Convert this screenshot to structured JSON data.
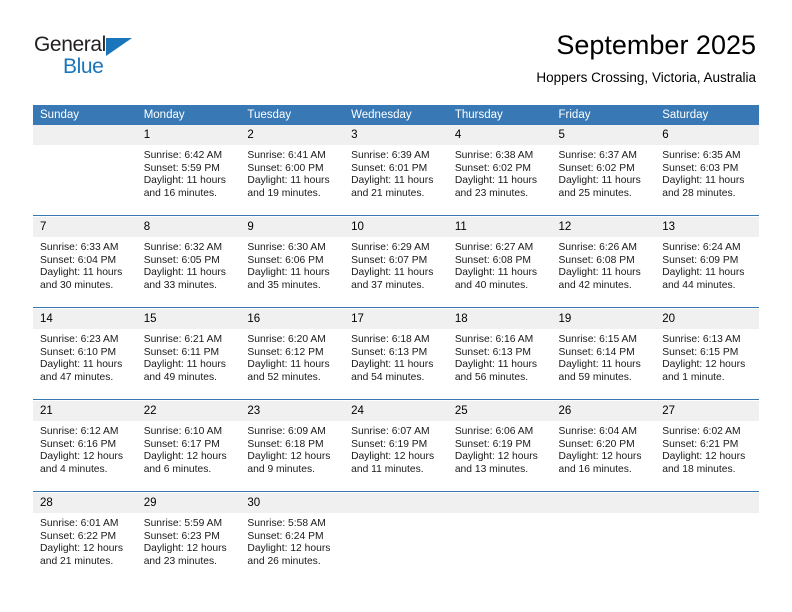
{
  "brand": {
    "name_top": "General",
    "name_bottom": "Blue",
    "triangle_color": "#1b75bb",
    "top_text_color": "#231f20"
  },
  "header": {
    "month_title": "September 2025",
    "location": "Hoppers Crossing, Victoria, Australia",
    "header_bg": "#3878b4",
    "date_bg": "#f0f0f0"
  },
  "calendar": {
    "weekday_headers": [
      "Sunday",
      "Monday",
      "Tuesday",
      "Wednesday",
      "Thursday",
      "Friday",
      "Saturday"
    ],
    "weeks": [
      [
        {
          "day": "",
          "sunrise": "",
          "sunset": "",
          "daylight1": "",
          "daylight2": ""
        },
        {
          "day": "1",
          "sunrise": "Sunrise: 6:42 AM",
          "sunset": "Sunset: 5:59 PM",
          "daylight1": "Daylight: 11 hours",
          "daylight2": "and 16 minutes."
        },
        {
          "day": "2",
          "sunrise": "Sunrise: 6:41 AM",
          "sunset": "Sunset: 6:00 PM",
          "daylight1": "Daylight: 11 hours",
          "daylight2": "and 19 minutes."
        },
        {
          "day": "3",
          "sunrise": "Sunrise: 6:39 AM",
          "sunset": "Sunset: 6:01 PM",
          "daylight1": "Daylight: 11 hours",
          "daylight2": "and 21 minutes."
        },
        {
          "day": "4",
          "sunrise": "Sunrise: 6:38 AM",
          "sunset": "Sunset: 6:02 PM",
          "daylight1": "Daylight: 11 hours",
          "daylight2": "and 23 minutes."
        },
        {
          "day": "5",
          "sunrise": "Sunrise: 6:37 AM",
          "sunset": "Sunset: 6:02 PM",
          "daylight1": "Daylight: 11 hours",
          "daylight2": "and 25 minutes."
        },
        {
          "day": "6",
          "sunrise": "Sunrise: 6:35 AM",
          "sunset": "Sunset: 6:03 PM",
          "daylight1": "Daylight: 11 hours",
          "daylight2": "and 28 minutes."
        }
      ],
      [
        {
          "day": "7",
          "sunrise": "Sunrise: 6:33 AM",
          "sunset": "Sunset: 6:04 PM",
          "daylight1": "Daylight: 11 hours",
          "daylight2": "and 30 minutes."
        },
        {
          "day": "8",
          "sunrise": "Sunrise: 6:32 AM",
          "sunset": "Sunset: 6:05 PM",
          "daylight1": "Daylight: 11 hours",
          "daylight2": "and 33 minutes."
        },
        {
          "day": "9",
          "sunrise": "Sunrise: 6:30 AM",
          "sunset": "Sunset: 6:06 PM",
          "daylight1": "Daylight: 11 hours",
          "daylight2": "and 35 minutes."
        },
        {
          "day": "10",
          "sunrise": "Sunrise: 6:29 AM",
          "sunset": "Sunset: 6:07 PM",
          "daylight1": "Daylight: 11 hours",
          "daylight2": "and 37 minutes."
        },
        {
          "day": "11",
          "sunrise": "Sunrise: 6:27 AM",
          "sunset": "Sunset: 6:08 PM",
          "daylight1": "Daylight: 11 hours",
          "daylight2": "and 40 minutes."
        },
        {
          "day": "12",
          "sunrise": "Sunrise: 6:26 AM",
          "sunset": "Sunset: 6:08 PM",
          "daylight1": "Daylight: 11 hours",
          "daylight2": "and 42 minutes."
        },
        {
          "day": "13",
          "sunrise": "Sunrise: 6:24 AM",
          "sunset": "Sunset: 6:09 PM",
          "daylight1": "Daylight: 11 hours",
          "daylight2": "and 44 minutes."
        }
      ],
      [
        {
          "day": "14",
          "sunrise": "Sunrise: 6:23 AM",
          "sunset": "Sunset: 6:10 PM",
          "daylight1": "Daylight: 11 hours",
          "daylight2": "and 47 minutes."
        },
        {
          "day": "15",
          "sunrise": "Sunrise: 6:21 AM",
          "sunset": "Sunset: 6:11 PM",
          "daylight1": "Daylight: 11 hours",
          "daylight2": "and 49 minutes."
        },
        {
          "day": "16",
          "sunrise": "Sunrise: 6:20 AM",
          "sunset": "Sunset: 6:12 PM",
          "daylight1": "Daylight: 11 hours",
          "daylight2": "and 52 minutes."
        },
        {
          "day": "17",
          "sunrise": "Sunrise: 6:18 AM",
          "sunset": "Sunset: 6:13 PM",
          "daylight1": "Daylight: 11 hours",
          "daylight2": "and 54 minutes."
        },
        {
          "day": "18",
          "sunrise": "Sunrise: 6:16 AM",
          "sunset": "Sunset: 6:13 PM",
          "daylight1": "Daylight: 11 hours",
          "daylight2": "and 56 minutes."
        },
        {
          "day": "19",
          "sunrise": "Sunrise: 6:15 AM",
          "sunset": "Sunset: 6:14 PM",
          "daylight1": "Daylight: 11 hours",
          "daylight2": "and 59 minutes."
        },
        {
          "day": "20",
          "sunrise": "Sunrise: 6:13 AM",
          "sunset": "Sunset: 6:15 PM",
          "daylight1": "Daylight: 12 hours",
          "daylight2": "and 1 minute."
        }
      ],
      [
        {
          "day": "21",
          "sunrise": "Sunrise: 6:12 AM",
          "sunset": "Sunset: 6:16 PM",
          "daylight1": "Daylight: 12 hours",
          "daylight2": "and 4 minutes."
        },
        {
          "day": "22",
          "sunrise": "Sunrise: 6:10 AM",
          "sunset": "Sunset: 6:17 PM",
          "daylight1": "Daylight: 12 hours",
          "daylight2": "and 6 minutes."
        },
        {
          "day": "23",
          "sunrise": "Sunrise: 6:09 AM",
          "sunset": "Sunset: 6:18 PM",
          "daylight1": "Daylight: 12 hours",
          "daylight2": "and 9 minutes."
        },
        {
          "day": "24",
          "sunrise": "Sunrise: 6:07 AM",
          "sunset": "Sunset: 6:19 PM",
          "daylight1": "Daylight: 12 hours",
          "daylight2": "and 11 minutes."
        },
        {
          "day": "25",
          "sunrise": "Sunrise: 6:06 AM",
          "sunset": "Sunset: 6:19 PM",
          "daylight1": "Daylight: 12 hours",
          "daylight2": "and 13 minutes."
        },
        {
          "day": "26",
          "sunrise": "Sunrise: 6:04 AM",
          "sunset": "Sunset: 6:20 PM",
          "daylight1": "Daylight: 12 hours",
          "daylight2": "and 16 minutes."
        },
        {
          "day": "27",
          "sunrise": "Sunrise: 6:02 AM",
          "sunset": "Sunset: 6:21 PM",
          "daylight1": "Daylight: 12 hours",
          "daylight2": "and 18 minutes."
        }
      ],
      [
        {
          "day": "28",
          "sunrise": "Sunrise: 6:01 AM",
          "sunset": "Sunset: 6:22 PM",
          "daylight1": "Daylight: 12 hours",
          "daylight2": "and 21 minutes."
        },
        {
          "day": "29",
          "sunrise": "Sunrise: 5:59 AM",
          "sunset": "Sunset: 6:23 PM",
          "daylight1": "Daylight: 12 hours",
          "daylight2": "and 23 minutes."
        },
        {
          "day": "30",
          "sunrise": "Sunrise: 5:58 AM",
          "sunset": "Sunset: 6:24 PM",
          "daylight1": "Daylight: 12 hours",
          "daylight2": "and 26 minutes."
        },
        {
          "day": "",
          "sunrise": "",
          "sunset": "",
          "daylight1": "",
          "daylight2": ""
        },
        {
          "day": "",
          "sunrise": "",
          "sunset": "",
          "daylight1": "",
          "daylight2": ""
        },
        {
          "day": "",
          "sunrise": "",
          "sunset": "",
          "daylight1": "",
          "daylight2": ""
        },
        {
          "day": "",
          "sunrise": "",
          "sunset": "",
          "daylight1": "",
          "daylight2": ""
        }
      ]
    ]
  }
}
